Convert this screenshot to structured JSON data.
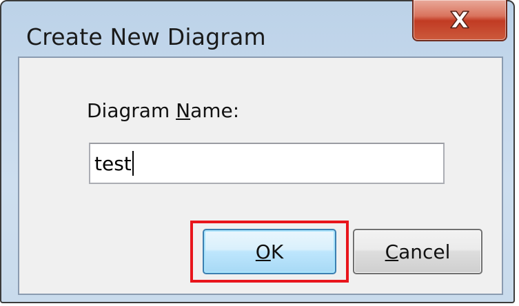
{
  "window": {
    "title": "Create New Diagram",
    "close_icon": "close-icon"
  },
  "form": {
    "label_prefix": "Diagram ",
    "label_mnemonic": "N",
    "label_rest": "ame:",
    "name_value": "test"
  },
  "buttons": {
    "ok_mnemonic": "O",
    "ok_rest": "K",
    "cancel_mnemonic": "C",
    "cancel_rest": "ancel"
  },
  "colors": {
    "highlight": "#e8151b",
    "close_button": "#c13b23",
    "ok_border": "#3c7fb1"
  }
}
